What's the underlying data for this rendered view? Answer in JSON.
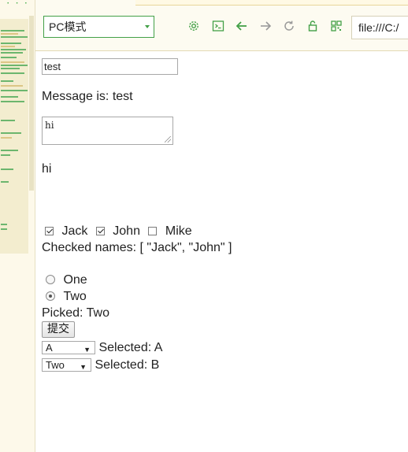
{
  "toolbar": {
    "mode_select_value": "PC模式",
    "icons": [
      "gear-icon",
      "terminal-icon",
      "arrow-left-icon",
      "arrow-right-icon",
      "refresh-icon",
      "lock-icon",
      "qr-code-icon"
    ],
    "address": "file:///C:/",
    "accent_color": "#43a047"
  },
  "page": {
    "message_input_value": "test",
    "message_label": "Message is: test",
    "textarea_value": "hi",
    "textarea_output": "hi",
    "checkboxes": [
      {
        "label": "Jack",
        "checked": true
      },
      {
        "label": "John",
        "checked": true
      },
      {
        "label": "Mike",
        "checked": false
      }
    ],
    "checked_names": "Checked names: [ \"Jack\", \"John\" ]",
    "radios": [
      {
        "label": "One",
        "checked": false
      },
      {
        "label": "Two",
        "checked": true
      }
    ],
    "picked": "Picked: Two",
    "submit_label": "提交",
    "select1_value": "A",
    "select1_label": "Selected: A",
    "select2_value": "Two",
    "select2_label": "Selected: B"
  }
}
